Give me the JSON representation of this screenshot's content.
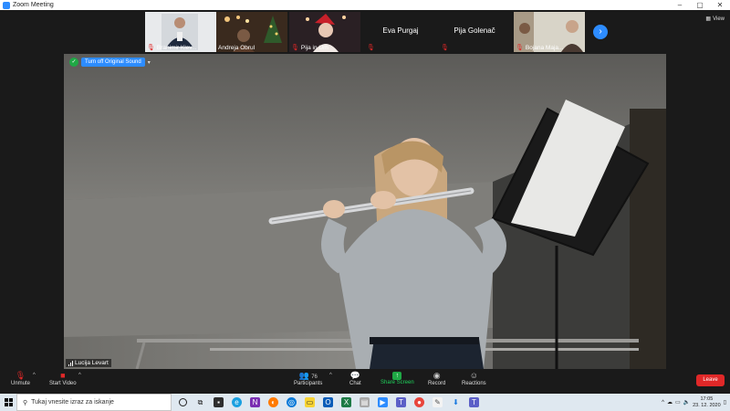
{
  "window": {
    "title": "Zoom Meeting"
  },
  "participants": [
    {
      "name": "Branimir Klev...",
      "muted": true
    },
    {
      "name": "Andreja Obrul",
      "muted": false
    },
    {
      "name": "Pija in Urh",
      "muted": true
    },
    {
      "name": "Eva Purgaj",
      "muted": true
    },
    {
      "name": "Pija Golenač",
      "muted": true
    },
    {
      "name": "Bojana Maja...",
      "muted": true
    }
  ],
  "view_label": "View",
  "main": {
    "original_sound_label": "Turn off Original Sound",
    "speaker_name": "Lucija Levart"
  },
  "toolbar": {
    "unmute": "Unmute",
    "start_video": "Start Video",
    "participants": "Participants",
    "participants_count": "76",
    "chat": "Chat",
    "share_screen": "Share Screen",
    "record": "Record",
    "reactions": "Reactions",
    "leave": "Leave"
  },
  "taskbar": {
    "search_placeholder": "Tukaj vnesite izraz za iskanje",
    "time": "17:05",
    "date": "23. 12. 2020"
  },
  "colors": {
    "accent": "#2d8cff",
    "muted_red": "#e02828",
    "share_green": "#1fa845",
    "leave_red": "#e02828"
  }
}
